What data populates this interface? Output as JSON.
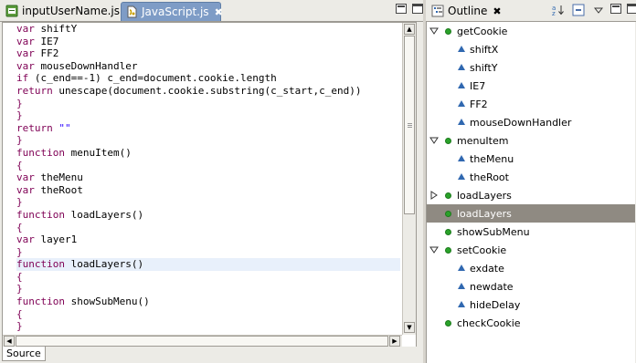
{
  "editor": {
    "tabs": [
      {
        "label": "inputUserName.jsp",
        "icon": "jsp-file-icon",
        "active": false
      },
      {
        "label": "JavaScript.js",
        "icon": "js-file-icon",
        "active": true,
        "close": "✖"
      }
    ],
    "code_lines": [
      {
        "kw": "var",
        "rest": " shiftY"
      },
      {
        "kw": "var",
        "rest": " IE7"
      },
      {
        "kw": "var",
        "rest": " FF2"
      },
      {
        "kw": "var",
        "rest": " mouseDownHandler"
      },
      {
        "kw": "if",
        "rest": " (c_end==-1) c_end=document.cookie.length"
      },
      {
        "kw": "return",
        "rest": " unescape(document.cookie.substring(c_start,c_end))"
      },
      {
        "kw": "",
        "rest": "}"
      },
      {
        "kw": "",
        "rest": "}"
      },
      {
        "kw": "return",
        "rest": " ",
        "str": "\"\""
      },
      {
        "kw": "",
        "rest": "}"
      },
      {
        "kw": "function",
        "rest": " menuItem()"
      },
      {
        "kw": "",
        "rest": "{"
      },
      {
        "kw": "var",
        "rest": " theMenu"
      },
      {
        "kw": "var",
        "rest": " theRoot"
      },
      {
        "kw": "",
        "rest": "}"
      },
      {
        "kw": "function",
        "rest": " loadLayers()"
      },
      {
        "kw": "",
        "rest": "{"
      },
      {
        "kw": "var",
        "rest": " layer1"
      },
      {
        "kw": "",
        "rest": "}"
      },
      {
        "kw": "function",
        "rest": " loadLayers()",
        "highlight": true
      },
      {
        "kw": "",
        "rest": "{"
      },
      {
        "kw": "",
        "rest": "}"
      },
      {
        "kw": "function",
        "rest": " showSubMenu()"
      },
      {
        "kw": "",
        "rest": "{"
      },
      {
        "kw": "",
        "rest": "}"
      }
    ],
    "bottom_tab": "Source"
  },
  "outline": {
    "title": "Outline",
    "close": "✖",
    "items": [
      {
        "label": "getCookie",
        "kind": "function",
        "depth": 0,
        "twisty": "expanded"
      },
      {
        "label": "shiftX",
        "kind": "variable",
        "depth": 1
      },
      {
        "label": "shiftY",
        "kind": "variable",
        "depth": 1
      },
      {
        "label": "IE7",
        "kind": "variable",
        "depth": 1
      },
      {
        "label": "FF2",
        "kind": "variable",
        "depth": 1
      },
      {
        "label": "mouseDownHandler",
        "kind": "variable",
        "depth": 1
      },
      {
        "label": "menuItem",
        "kind": "function",
        "depth": 0,
        "twisty": "expanded"
      },
      {
        "label": "theMenu",
        "kind": "variable",
        "depth": 1
      },
      {
        "label": "theRoot",
        "kind": "variable",
        "depth": 1
      },
      {
        "label": "loadLayers",
        "kind": "function",
        "depth": 0,
        "twisty": "collapsed"
      },
      {
        "label": "loadLayers",
        "kind": "function",
        "depth": 0,
        "selected": true
      },
      {
        "label": "showSubMenu",
        "kind": "function",
        "depth": 0
      },
      {
        "label": "setCookie",
        "kind": "function",
        "depth": 0,
        "twisty": "expanded"
      },
      {
        "label": "exdate",
        "kind": "variable",
        "depth": 1
      },
      {
        "label": "newdate",
        "kind": "variable",
        "depth": 1
      },
      {
        "label": "hideDelay",
        "kind": "variable",
        "depth": 1
      },
      {
        "label": "checkCookie",
        "kind": "function",
        "depth": 0
      }
    ]
  },
  "colors": {
    "keyword": "#7f0055",
    "string": "#2a00ff",
    "active_tab": "#7e9cc6",
    "selection": "#8f8a82",
    "function_dot": "#2aa22a",
    "variable_triangle": "#3068b0"
  }
}
